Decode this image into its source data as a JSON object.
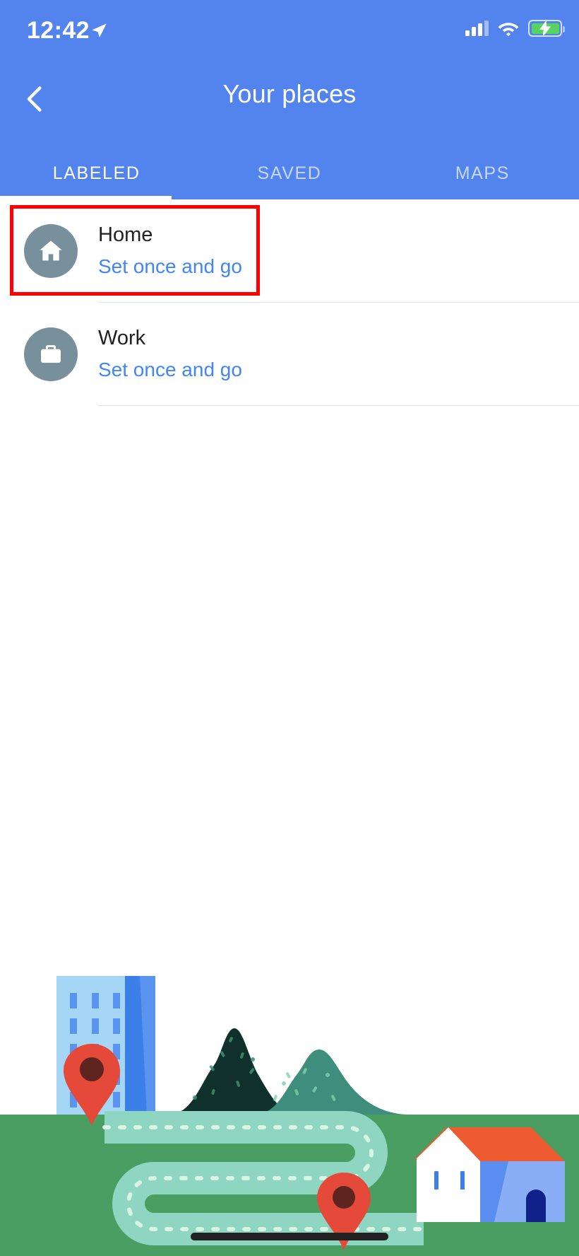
{
  "status_bar": {
    "time": "12:42",
    "location_icon": "location-arrow-icon",
    "signal_icon": "cellular-signal-icon",
    "signal_bars_filled": 3,
    "signal_bars_total": 4,
    "wifi_icon": "wifi-icon",
    "battery_icon": "battery-charging-icon",
    "battery_charging": true,
    "battery_color": "#57d45f"
  },
  "header": {
    "back_icon": "back-chevron-icon",
    "title": "Your places",
    "background_color": "#5384ee",
    "tabs": [
      {
        "label": "LABELED",
        "active": true
      },
      {
        "label": "SAVED",
        "active": false
      },
      {
        "label": "MAPS",
        "active": false
      }
    ]
  },
  "list": {
    "items": [
      {
        "icon": "home-icon",
        "title": "Home",
        "subtitle": "Set once and go",
        "highlighted": true
      },
      {
        "icon": "briefcase-icon",
        "title": "Work",
        "subtitle": "Set once and go",
        "highlighted": false
      }
    ],
    "avatar_color": "#78909c",
    "subtitle_color": "#4285f4",
    "highlight_color": "#ff0000"
  },
  "illustration": {
    "name": "places-empty-state-illustration",
    "elements": [
      "office-building",
      "map-pin-left",
      "dark-mountain",
      "teal-hill",
      "dotted-route-path",
      "house",
      "map-pin-right",
      "grass-field"
    ],
    "colors": {
      "grass": "#4a9e62",
      "road": "#8fd6c2",
      "building_light": "#a6d6f5",
      "building_dark": "#4285f4",
      "mountain_dark": "#10302c",
      "hill_teal": "#3f8d7d",
      "pin_red": "#e5493a",
      "pin_center": "#5e2420",
      "roof_orange": "#ef5b31",
      "house_wall": "#ffffff",
      "house_side": "#6f9cf0",
      "door": "#11218a"
    }
  },
  "bottom_bar": {
    "home_indicator": "home-indicator-bar",
    "color": "#222222"
  }
}
